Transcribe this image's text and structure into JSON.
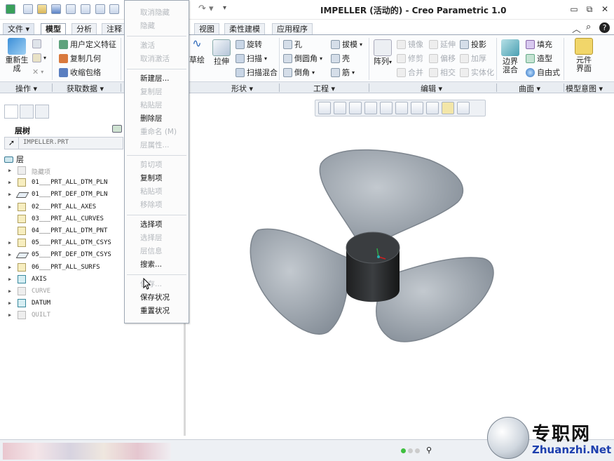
{
  "title": "IMPELLER (活动的) - Creo Parametric 1.0",
  "window_buttons": [
    "▭",
    "⧉",
    "✕"
  ],
  "tabs": [
    {
      "label": "文件 ▾",
      "active": false
    },
    {
      "label": "模型",
      "active": true
    },
    {
      "label": "分析",
      "active": false
    },
    {
      "label": "注释",
      "active": false
    },
    {
      "label": "视图",
      "active": false
    },
    {
      "label": "柔性建模",
      "active": false
    },
    {
      "label": "应用程序",
      "active": false
    }
  ],
  "ribbon": {
    "regenerate": "重新生成",
    "user_feature": "用户定义特征",
    "copy_geometry": "复制几何",
    "shrinkwrap": "收缩包络",
    "sweep_label": "草绘",
    "extrude": "拉伸",
    "revolve": "旋转",
    "sweep": "扫描",
    "swept_blend": "扫描混合",
    "hole": "孔",
    "round": "倒圆角",
    "chamfer": "倒角",
    "draft": "拔模",
    "shell": "壳",
    "rib": "筋",
    "pattern": "阵列",
    "mirror": "镜像",
    "trim": "修剪",
    "merge": "合并",
    "extend": "延伸",
    "offset": "偏移",
    "intersect": "相交",
    "project": "投影",
    "thicken": "加厚",
    "solidify": "实体化",
    "boundary_blend": "边界混合",
    "fill": "填充",
    "style": "造型",
    "freestyle": "自由式",
    "component_interface": "元件界面"
  },
  "groups": [
    "操作 ▾",
    "获取数据 ▾",
    "形状 ▾",
    "工程 ▾",
    "编辑 ▾",
    "曲面 ▾",
    "模型意图 ▾"
  ],
  "panel": {
    "tree_title": "层树",
    "part_name": "IMPELLER.PRT",
    "root": "层",
    "rows": [
      {
        "label": "隐藏项",
        "grey": true,
        "icon": "gray"
      },
      {
        "label": "01___PRT_ALL_DTM_PLN",
        "grey": false,
        "icon": "layer"
      },
      {
        "label": "01___PRT_DEF_DTM_PLN",
        "grey": false,
        "icon": "plane"
      },
      {
        "label": "02___PRT_ALL_AXES",
        "grey": false,
        "icon": "layer"
      },
      {
        "label": "03___PRT_ALL_CURVES",
        "grey": false,
        "icon": "layer"
      },
      {
        "label": "04___PRT_ALL_DTM_PNT",
        "grey": false,
        "icon": "layer"
      },
      {
        "label": "05___PRT_ALL_DTM_CSYS",
        "grey": false,
        "icon": "layer"
      },
      {
        "label": "05___PRT_DEF_DTM_CSYS",
        "grey": false,
        "icon": "plane"
      },
      {
        "label": "06___PRT_ALL_SURFS",
        "grey": false,
        "icon": "layer"
      },
      {
        "label": "AXIS",
        "grey": false,
        "icon": "axis"
      },
      {
        "label": "CURVE",
        "grey": true,
        "icon": "gray"
      },
      {
        "label": "DATUM",
        "grey": false,
        "icon": "axis"
      },
      {
        "label": "QUILT",
        "grey": true,
        "icon": "gray"
      }
    ]
  },
  "context_menu": [
    {
      "label": "取消隐藏",
      "enabled": false
    },
    {
      "label": "隐藏",
      "enabled": false
    },
    {
      "sep": true
    },
    {
      "label": "激活",
      "enabled": false
    },
    {
      "label": "取消激活",
      "enabled": false
    },
    {
      "sep": true
    },
    {
      "label": "新建层...",
      "enabled": true
    },
    {
      "label": "复制层",
      "enabled": false
    },
    {
      "label": "粘贴层",
      "enabled": false
    },
    {
      "label": "删除层",
      "enabled": true
    },
    {
      "label": "重命名 (M)",
      "enabled": false
    },
    {
      "label": "层属性...",
      "enabled": false
    },
    {
      "sep": true
    },
    {
      "label": "剪切项",
      "enabled": false
    },
    {
      "label": "复制项",
      "enabled": true
    },
    {
      "label": "粘贴项",
      "enabled": false
    },
    {
      "label": "移除项",
      "enabled": false
    },
    {
      "sep": true
    },
    {
      "label": "选择项",
      "enabled": true
    },
    {
      "label": "选择层",
      "enabled": false
    },
    {
      "label": "层信息",
      "enabled": false
    },
    {
      "label": "搜索...",
      "enabled": true
    },
    {
      "sep": true
    },
    {
      "label": "保存...",
      "enabled": false
    },
    {
      "label": "保存状况",
      "enabled": true
    },
    {
      "label": "重置状况",
      "enabled": true
    }
  ],
  "watermark": {
    "text": "专职网",
    "url": "Zhuanzhi.Net"
  },
  "colors": {
    "accent": "#1d3fae",
    "blade": "#9aa2aa",
    "hub": "#2a2c2e"
  }
}
